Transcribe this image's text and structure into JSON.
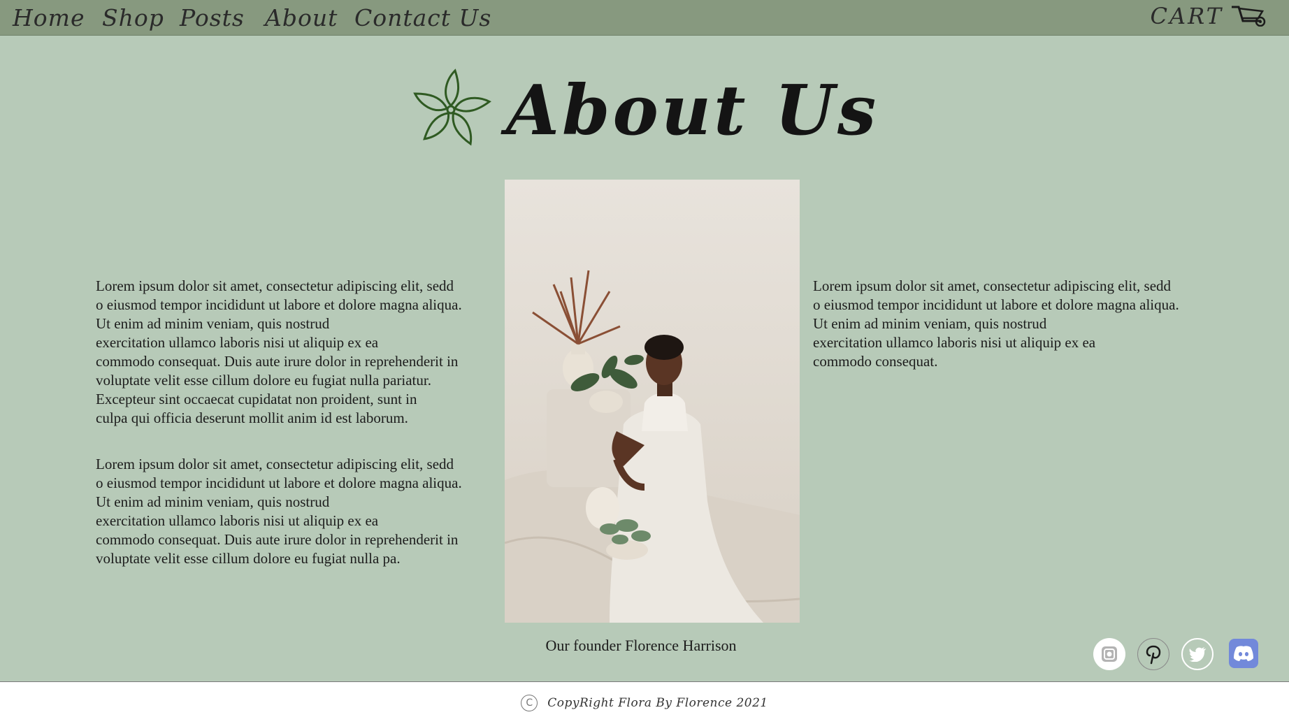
{
  "nav": {
    "items": [
      {
        "label": "Home"
      },
      {
        "label": "Shop"
      },
      {
        "label": "Posts"
      },
      {
        "label": "About"
      },
      {
        "label": "Contact Us"
      }
    ],
    "cart_label": "CART"
  },
  "header": {
    "title": "About Us"
  },
  "content": {
    "left_paragraphs": [
      "Lorem ipsum dolor sit amet, consectetur adipiscing elit, sedd\no eiusmod tempor incididunt ut labore et dolore magna aliqua.\nUt enim ad minim veniam, quis nostrud\nexercitation ullamco laboris nisi ut aliquip ex ea\ncommodo consequat. Duis aute irure dolor in reprehenderit in\nvoluptate velit esse cillum dolore eu fugiat nulla pariatur.\nExcepteur sint occaecat cupidatat non proident, sunt in\nculpa qui officia deserunt mollit anim id est laborum.",
      "Lorem ipsum dolor sit amet, consectetur adipiscing elit, sedd\no eiusmod tempor incididunt ut labore et dolore magna aliqua.\nUt enim ad minim veniam, quis nostrud\nexercitation ullamco laboris nisi ut aliquip ex ea\ncommodo consequat. Duis aute irure dolor in reprehenderit in\nvoluptate velit esse cillum dolore eu fugiat nulla pa."
    ],
    "right_paragraph": "Lorem ipsum dolor sit amet, consectetur adipiscing elit, sedd\no eiusmod tempor incididunt ut labore et dolore magna aliqua.\nUt enim ad minim veniam, quis nostrud\nexercitation ullamco laboris nisi ut aliquip ex ea\ncommodo consequat.",
    "caption": "Our founder Florence Harrison"
  },
  "social": {
    "icons": [
      "instagram-icon",
      "pinterest-icon",
      "twitter-icon",
      "discord-icon"
    ]
  },
  "footer": {
    "copyright_symbol": "C",
    "copyright_text": "CopyRight Flora By Florence 2021"
  },
  "colors": {
    "background": "#b7cab8",
    "navbar": "#87997f",
    "flower_icon": "#2f5a22",
    "discord": "#7289da",
    "footer": "#ffffff"
  }
}
